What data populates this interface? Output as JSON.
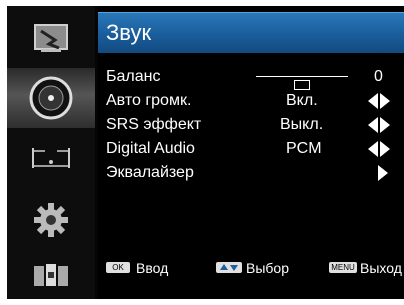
{
  "header": {
    "title": "Звук"
  },
  "sidebar": {
    "items": [
      {
        "icon": "picture-icon",
        "active": false
      },
      {
        "icon": "sound-icon",
        "active": true
      },
      {
        "icon": "channel-icon",
        "active": false
      },
      {
        "icon": "settings-icon",
        "active": false
      },
      {
        "icon": "lock-icon",
        "active": false
      }
    ]
  },
  "menu": {
    "balance": {
      "label": "Баланс",
      "value": "0",
      "level": 0.5
    },
    "auto_volume": {
      "label": "Авто громк.",
      "value": "Вкл."
    },
    "srs": {
      "label": "SRS эффект",
      "value": "Выкл."
    },
    "digital_audio": {
      "label": "Digital Audio",
      "value": "PCM"
    },
    "equalizer": {
      "label": "Эквалайзер"
    }
  },
  "footer": {
    "enter_key": "OK",
    "enter_label": "Ввод",
    "select_label": "Выбор",
    "exit_key": "MENU",
    "exit_label": "Выход"
  },
  "colors": {
    "header": "#1b5f9e",
    "background": "#000000",
    "text": "#ffffff"
  }
}
